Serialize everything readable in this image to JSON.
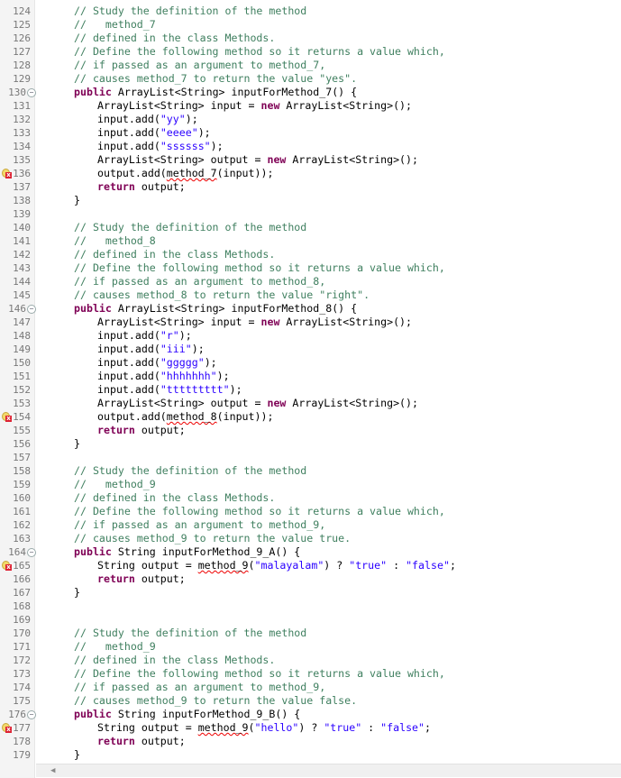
{
  "editor": {
    "fold_icon": "collapse-icon",
    "error_icon": "error-quickfix-icon",
    "colors": {
      "comment": "#3f7f5f",
      "keyword": "#7f0055",
      "string": "#2a00ff",
      "error": "#ee0000"
    },
    "lines": [
      {
        "n": "124",
        "i": 1,
        "t": [
          [
            "c",
            "// Study the definition of the method"
          ]
        ]
      },
      {
        "n": "125",
        "i": 1,
        "t": [
          [
            "c",
            "//   method_7"
          ]
        ]
      },
      {
        "n": "126",
        "i": 1,
        "t": [
          [
            "c",
            "// defined in the class Methods."
          ]
        ]
      },
      {
        "n": "127",
        "i": 1,
        "t": [
          [
            "c",
            "// Define the following method so it returns a value which,"
          ]
        ]
      },
      {
        "n": "128",
        "i": 1,
        "t": [
          [
            "c",
            "// if passed as an argument to method_7,"
          ]
        ]
      },
      {
        "n": "129",
        "i": 1,
        "t": [
          [
            "c",
            "// causes method_7 to return the value \"yes\"."
          ]
        ]
      },
      {
        "n": "130",
        "i": 1,
        "fold": true,
        "t": [
          [
            "k",
            "public"
          ],
          [
            "p",
            " ArrayList<String> inputForMethod_7() {"
          ]
        ]
      },
      {
        "n": "131",
        "i": 2,
        "t": [
          [
            "p",
            "ArrayList<String> input = "
          ],
          [
            "k",
            "new"
          ],
          [
            "p",
            " ArrayList<String>();"
          ]
        ]
      },
      {
        "n": "132",
        "i": 2,
        "t": [
          [
            "p",
            "input.add("
          ],
          [
            "s",
            "\"yy\""
          ],
          [
            "p",
            ");"
          ]
        ]
      },
      {
        "n": "133",
        "i": 2,
        "t": [
          [
            "p",
            "input.add("
          ],
          [
            "s",
            "\"eeee\""
          ],
          [
            "p",
            ");"
          ]
        ]
      },
      {
        "n": "134",
        "i": 2,
        "t": [
          [
            "p",
            "input.add("
          ],
          [
            "s",
            "\"ssssss\""
          ],
          [
            "p",
            ");"
          ]
        ]
      },
      {
        "n": "135",
        "i": 2,
        "t": [
          [
            "p",
            "ArrayList<String> output = "
          ],
          [
            "k",
            "new"
          ],
          [
            "p",
            " ArrayList<String>();"
          ]
        ]
      },
      {
        "n": "136",
        "i": 2,
        "err": true,
        "t": [
          [
            "p",
            "output.add("
          ],
          [
            "e",
            "method_7"
          ],
          [
            "p",
            "(input));"
          ]
        ]
      },
      {
        "n": "137",
        "i": 2,
        "t": [
          [
            "k",
            "return"
          ],
          [
            "p",
            " output;"
          ]
        ]
      },
      {
        "n": "138",
        "i": 1,
        "t": [
          [
            "p",
            "}"
          ]
        ]
      },
      {
        "n": "139",
        "i": 0,
        "t": []
      },
      {
        "n": "140",
        "i": 1,
        "t": [
          [
            "c",
            "// Study the definition of the method"
          ]
        ]
      },
      {
        "n": "141",
        "i": 1,
        "t": [
          [
            "c",
            "//   method_8"
          ]
        ]
      },
      {
        "n": "142",
        "i": 1,
        "t": [
          [
            "c",
            "// defined in the class Methods."
          ]
        ]
      },
      {
        "n": "143",
        "i": 1,
        "t": [
          [
            "c",
            "// Define the following method so it returns a value which,"
          ]
        ]
      },
      {
        "n": "144",
        "i": 1,
        "t": [
          [
            "c",
            "// if passed as an argument to method_8,"
          ]
        ]
      },
      {
        "n": "145",
        "i": 1,
        "t": [
          [
            "c",
            "// causes method_8 to return the value \"right\"."
          ]
        ]
      },
      {
        "n": "146",
        "i": 1,
        "fold": true,
        "t": [
          [
            "k",
            "public"
          ],
          [
            "p",
            " ArrayList<String> inputForMethod_8() {"
          ]
        ]
      },
      {
        "n": "147",
        "i": 2,
        "t": [
          [
            "p",
            "ArrayList<String> input = "
          ],
          [
            "k",
            "new"
          ],
          [
            "p",
            " ArrayList<String>();"
          ]
        ]
      },
      {
        "n": "148",
        "i": 2,
        "t": [
          [
            "p",
            "input.add("
          ],
          [
            "s",
            "\"r\""
          ],
          [
            "p",
            ");"
          ]
        ]
      },
      {
        "n": "149",
        "i": 2,
        "t": [
          [
            "p",
            "input.add("
          ],
          [
            "s",
            "\"iii\""
          ],
          [
            "p",
            ");"
          ]
        ]
      },
      {
        "n": "150",
        "i": 2,
        "t": [
          [
            "p",
            "input.add("
          ],
          [
            "s",
            "\"ggggg\""
          ],
          [
            "p",
            ");"
          ]
        ]
      },
      {
        "n": "151",
        "i": 2,
        "t": [
          [
            "p",
            "input.add("
          ],
          [
            "s",
            "\"hhhhhhh\""
          ],
          [
            "p",
            ");"
          ]
        ]
      },
      {
        "n": "152",
        "i": 2,
        "t": [
          [
            "p",
            "input.add("
          ],
          [
            "s",
            "\"ttttttttt\""
          ],
          [
            "p",
            ");"
          ]
        ]
      },
      {
        "n": "153",
        "i": 2,
        "t": [
          [
            "p",
            "ArrayList<String> output = "
          ],
          [
            "k",
            "new"
          ],
          [
            "p",
            " ArrayList<String>();"
          ]
        ]
      },
      {
        "n": "154",
        "i": 2,
        "err": true,
        "t": [
          [
            "p",
            "output.add("
          ],
          [
            "e",
            "method_8"
          ],
          [
            "p",
            "(input));"
          ]
        ]
      },
      {
        "n": "155",
        "i": 2,
        "t": [
          [
            "k",
            "return"
          ],
          [
            "p",
            " output;"
          ]
        ]
      },
      {
        "n": "156",
        "i": 1,
        "t": [
          [
            "p",
            "}"
          ]
        ]
      },
      {
        "n": "157",
        "i": 0,
        "t": []
      },
      {
        "n": "158",
        "i": 1,
        "t": [
          [
            "c",
            "// Study the definition of the method"
          ]
        ]
      },
      {
        "n": "159",
        "i": 1,
        "t": [
          [
            "c",
            "//   method_9"
          ]
        ]
      },
      {
        "n": "160",
        "i": 1,
        "t": [
          [
            "c",
            "// defined in the class Methods."
          ]
        ]
      },
      {
        "n": "161",
        "i": 1,
        "t": [
          [
            "c",
            "// Define the following method so it returns a value which,"
          ]
        ]
      },
      {
        "n": "162",
        "i": 1,
        "t": [
          [
            "c",
            "// if passed as an argument to method_9,"
          ]
        ]
      },
      {
        "n": "163",
        "i": 1,
        "t": [
          [
            "c",
            "// causes method_9 to return the value true."
          ]
        ]
      },
      {
        "n": "164",
        "i": 1,
        "fold": true,
        "t": [
          [
            "k",
            "public"
          ],
          [
            "p",
            " String inputForMethod_9_A() {"
          ]
        ]
      },
      {
        "n": "165",
        "i": 2,
        "err": true,
        "t": [
          [
            "p",
            "String output = "
          ],
          [
            "e",
            "method_9"
          ],
          [
            "p",
            "("
          ],
          [
            "s",
            "\"malayalam\""
          ],
          [
            "p",
            ") ? "
          ],
          [
            "s",
            "\"true\""
          ],
          [
            "p",
            " : "
          ],
          [
            "s",
            "\"false\""
          ],
          [
            "p",
            ";"
          ]
        ]
      },
      {
        "n": "166",
        "i": 2,
        "t": [
          [
            "k",
            "return"
          ],
          [
            "p",
            " output;"
          ]
        ]
      },
      {
        "n": "167",
        "i": 1,
        "t": [
          [
            "p",
            "}"
          ]
        ]
      },
      {
        "n": "168",
        "i": 0,
        "t": []
      },
      {
        "n": "169",
        "i": 0,
        "t": []
      },
      {
        "n": "170",
        "i": 1,
        "t": [
          [
            "c",
            "// Study the definition of the method"
          ]
        ]
      },
      {
        "n": "171",
        "i": 1,
        "t": [
          [
            "c",
            "//   method_9"
          ]
        ]
      },
      {
        "n": "172",
        "i": 1,
        "t": [
          [
            "c",
            "// defined in the class Methods."
          ]
        ]
      },
      {
        "n": "173",
        "i": 1,
        "t": [
          [
            "c",
            "// Define the following method so it returns a value which,"
          ]
        ]
      },
      {
        "n": "174",
        "i": 1,
        "t": [
          [
            "c",
            "// if passed as an argument to method_9,"
          ]
        ]
      },
      {
        "n": "175",
        "i": 1,
        "t": [
          [
            "c",
            "// causes method_9 to return the value false."
          ]
        ]
      },
      {
        "n": "176",
        "i": 1,
        "fold": true,
        "t": [
          [
            "k",
            "public"
          ],
          [
            "p",
            " String inputForMethod_9_B() {"
          ]
        ]
      },
      {
        "n": "177",
        "i": 2,
        "err": true,
        "t": [
          [
            "p",
            "String output = "
          ],
          [
            "e",
            "method_9"
          ],
          [
            "p",
            "("
          ],
          [
            "s",
            "\"hello\""
          ],
          [
            "p",
            ") ? "
          ],
          [
            "s",
            "\"true\""
          ],
          [
            "p",
            " : "
          ],
          [
            "s",
            "\"false\""
          ],
          [
            "p",
            ";"
          ]
        ]
      },
      {
        "n": "178",
        "i": 2,
        "t": [
          [
            "k",
            "return"
          ],
          [
            "p",
            " output;"
          ]
        ]
      },
      {
        "n": "179",
        "i": 1,
        "t": [
          [
            "p",
            "}"
          ]
        ]
      }
    ]
  }
}
